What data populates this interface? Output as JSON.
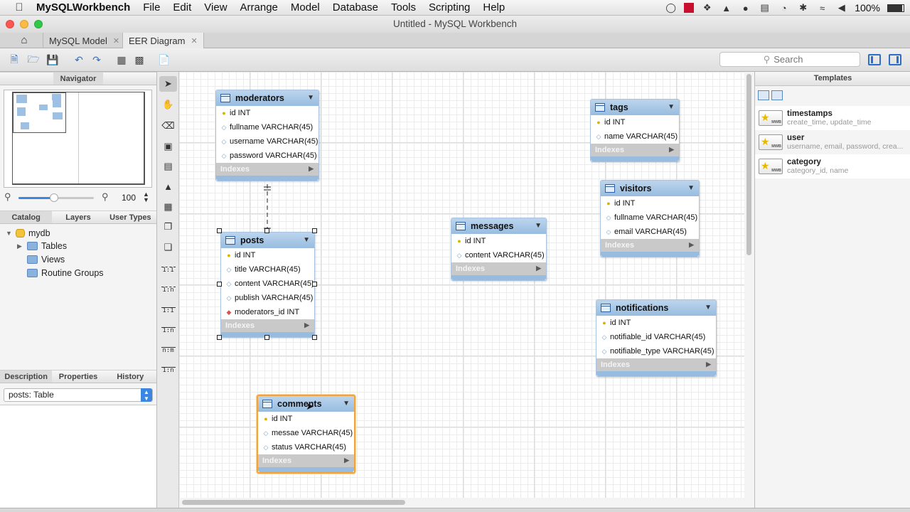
{
  "menubar": {
    "app_name": "MySQLWorkbench",
    "items": [
      "File",
      "Edit",
      "View",
      "Arrange",
      "Model",
      "Database",
      "Tools",
      "Scripting",
      "Help"
    ],
    "battery": "100%"
  },
  "window": {
    "title": "Untitled - MySQL Workbench"
  },
  "tabs": [
    {
      "label": "MySQL Model",
      "active": false
    },
    {
      "label": "EER Diagram",
      "active": true
    }
  ],
  "toolbar": {
    "search_placeholder": "Search"
  },
  "left_panel": {
    "navigator_label": "Navigator",
    "zoom_value": "100",
    "catalog_tabs": [
      "Catalog",
      "Layers",
      "User Types"
    ],
    "tree": {
      "schema": "mydb",
      "children": [
        "Tables",
        "Views",
        "Routine Groups"
      ]
    },
    "bottom_tabs": [
      "Description",
      "Properties",
      "History"
    ],
    "object_select": "posts: Table"
  },
  "diagram": {
    "tables": [
      {
        "name": "moderators",
        "columns": [
          {
            "key": "pk",
            "text": "id INT"
          },
          {
            "key": "nn",
            "text": "fullname VARCHAR(45)"
          },
          {
            "key": "nn",
            "text": "username VARCHAR(45)"
          },
          {
            "key": "nn",
            "text": "password VARCHAR(45)"
          }
        ],
        "indexes_label": "Indexes"
      },
      {
        "name": "posts",
        "columns": [
          {
            "key": "pk",
            "text": "id INT"
          },
          {
            "key": "nn",
            "text": "title VARCHAR(45)"
          },
          {
            "key": "nn",
            "text": "content VARCHAR(45)"
          },
          {
            "key": "nn",
            "text": "publish VARCHAR(45)"
          },
          {
            "key": "fk",
            "text": "moderators_id INT"
          }
        ],
        "indexes_label": "Indexes"
      },
      {
        "name": "comments",
        "columns": [
          {
            "key": "pk",
            "text": "id INT"
          },
          {
            "key": "nn",
            "text": "messae VARCHAR(45)"
          },
          {
            "key": "nn",
            "text": "status VARCHAR(45)"
          }
        ],
        "indexes_label": "Indexes"
      },
      {
        "name": "messages",
        "columns": [
          {
            "key": "pk",
            "text": "id INT"
          },
          {
            "key": "nn",
            "text": "content VARCHAR(45)"
          }
        ],
        "indexes_label": "Indexes"
      },
      {
        "name": "tags",
        "columns": [
          {
            "key": "pk",
            "text": "id INT"
          },
          {
            "key": "nn",
            "text": "name VARCHAR(45)"
          }
        ],
        "indexes_label": "Indexes"
      },
      {
        "name": "visitors",
        "columns": [
          {
            "key": "pk",
            "text": "id INT"
          },
          {
            "key": "nn",
            "text": "fullname VARCHAR(45)"
          },
          {
            "key": "nn",
            "text": "email VARCHAR(45)"
          }
        ],
        "indexes_label": "Indexes"
      },
      {
        "name": "notifications",
        "columns": [
          {
            "key": "pk",
            "text": "id INT"
          },
          {
            "key": "nn",
            "text": "notifiable_id VARCHAR(45)"
          },
          {
            "key": "nn",
            "text": "notifiable_type VARCHAR(45)"
          }
        ],
        "indexes_label": "Indexes"
      }
    ],
    "relationship_tools": [
      "1:1",
      "1:n",
      "1:1",
      "1:n",
      "n:m",
      "1:n"
    ]
  },
  "right_panel": {
    "title": "Templates",
    "templates": [
      {
        "name": "timestamps",
        "desc": "create_time, update_time"
      },
      {
        "name": "user",
        "desc": "username, email, password, crea..."
      },
      {
        "name": "category",
        "desc": "category_id, name"
      }
    ]
  },
  "colors": {
    "table_header": "#98bcdf",
    "selection_orange": "#f3a33c",
    "accent_blue": "#3b86e0"
  }
}
